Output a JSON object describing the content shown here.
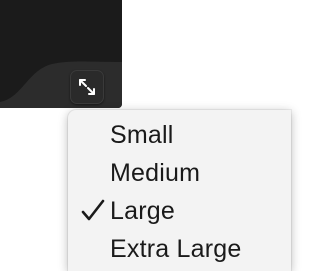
{
  "resize_button": {
    "icon": "expand-arrows-icon"
  },
  "size_menu": {
    "items": [
      {
        "label": "Small",
        "checked": false
      },
      {
        "label": "Medium",
        "checked": false
      },
      {
        "label": "Large",
        "checked": true
      },
      {
        "label": "Extra Large",
        "checked": false
      }
    ],
    "check_icon": "checkmark-icon"
  }
}
